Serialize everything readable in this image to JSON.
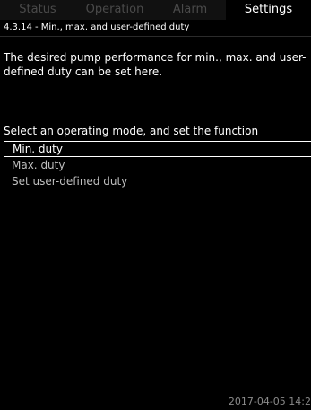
{
  "tabs": [
    {
      "label": "Status",
      "active": false
    },
    {
      "label": "Operation",
      "active": false
    },
    {
      "label": "Alarm",
      "active": false
    },
    {
      "label": "Settings",
      "active": true
    }
  ],
  "breadcrumb": "4.3.14 - Min., max. and user-defined duty",
  "description": "The desired pump performance for min., max. and user-defined duty can be set here.",
  "select_prompt": "Select an operating mode, and set the function",
  "options": [
    {
      "label": "Min. duty",
      "selected": true
    },
    {
      "label": "Max. duty",
      "selected": false
    },
    {
      "label": "Set user-defined duty",
      "selected": false
    }
  ],
  "timestamp": "2017-04-05 14:2",
  "colors": {
    "background": "#000000",
    "active_text": "#ffffff",
    "inactive_tab_text": "#4a4a4a",
    "option_text": "#bfbfbf"
  }
}
